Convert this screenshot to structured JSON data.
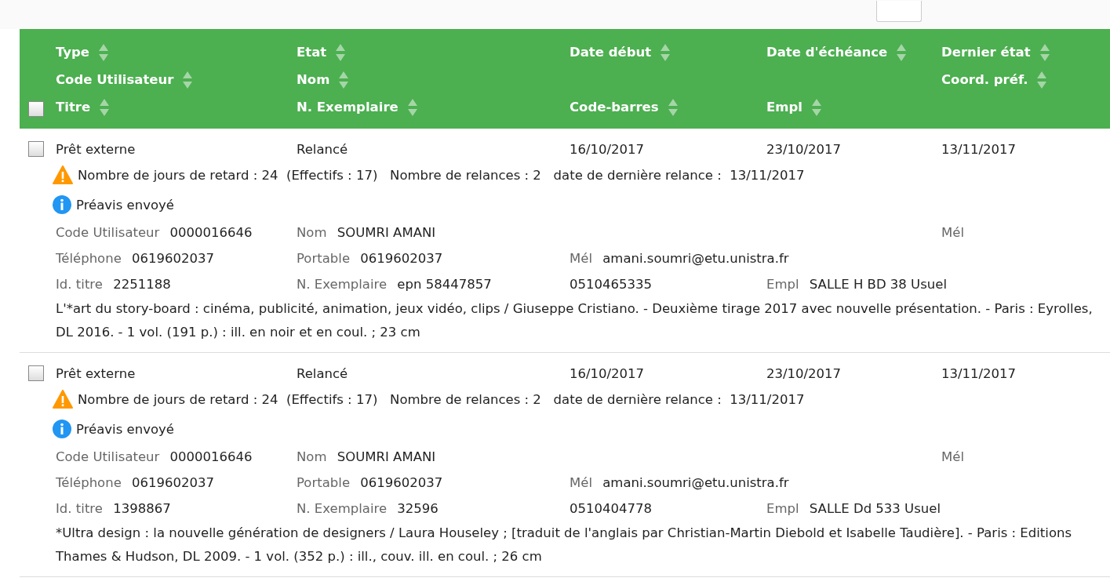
{
  "header": {
    "selected": false,
    "columns": [
      {
        "top": "Type",
        "middle": "Code Utilisateur",
        "bottom": "Titre"
      },
      {
        "top": "Etat",
        "middle": "Nom",
        "bottom": "N. Exemplaire"
      },
      {
        "top": "Date début",
        "bottom": "Code-barres"
      },
      {
        "top": "Date d'échéance",
        "bottom": "Empl"
      },
      {
        "top": "Dernier état",
        "middle": "Coord. préf."
      }
    ]
  },
  "rows": [
    {
      "selected": false,
      "cells": [
        "Prêt externe",
        "Relancé",
        "16/10/2017",
        "23/10/2017",
        "13/11/2017"
      ],
      "warning": "Nombre de jours de retard : 24  (Effectifs : 17)   Nombre de relances : 2   date de dernière relance :  13/11/2017",
      "info": "Préavis envoyé",
      "details": [
        {
          "column_1": {
            "label": "Code Utilisateur",
            "value": "0000016646"
          },
          "column_2": {
            "label": "Nom",
            "value": "SOUMRI AMANI"
          },
          "column_5": {
            "label": "Mél"
          }
        },
        {
          "column_1": {
            "label": "Téléphone",
            "value": "0619602037"
          },
          "column_2": {
            "label": "Portable",
            "value": "0619602037"
          },
          "column_3": {
            "label": "Mél",
            "value": "amani.soumri@etu.unistra.fr"
          }
        },
        {
          "column_1": {
            "label": "Id. titre",
            "value": "2251188"
          },
          "column_2": {
            "label": "N. Exemplaire",
            "value": "epn 58447857"
          },
          "column_3": {
            "value": "0510465335"
          },
          "column_4": {
            "label": "Empl",
            "value": "SALLE H BD 38 Usuel"
          }
        }
      ],
      "description": "L'*art du story-board : cinéma, publicité, animation, jeux vidéo, clips / Giuseppe Cristiano. - Deuxième tirage 2017 avec nouvelle présentation. - Paris : Eyrolles, DL 2016. - 1 vol. (191 p.) : ill. en noir et en coul. ; 23 cm"
    },
    {
      "selected": false,
      "cells": [
        "Prêt externe",
        "Relancé",
        "16/10/2017",
        "23/10/2017",
        "13/11/2017"
      ],
      "warning": "Nombre de jours de retard : 24  (Effectifs : 17)   Nombre de relances : 2   date de dernière relance :  13/11/2017",
      "info": "Préavis envoyé",
      "details": [
        {
          "column_1": {
            "label": "Code Utilisateur",
            "value": "0000016646"
          },
          "column_2": {
            "label": "Nom",
            "value": "SOUMRI AMANI"
          },
          "column_5": {
            "label": "Mél"
          }
        },
        {
          "column_1": {
            "label": "Téléphone",
            "value": "0619602037"
          },
          "column_2": {
            "label": "Portable",
            "value": "0619602037"
          },
          "column_3": {
            "label": "Mél",
            "value": "amani.soumri@etu.unistra.fr"
          }
        },
        {
          "column_1": {
            "label": "Id. titre",
            "value": "1398867"
          },
          "column_2": {
            "label": "N. Exemplaire",
            "value": "32596"
          },
          "column_3": {
            "value": "0510404778"
          },
          "column_4": {
            "label": "Empl",
            "value": "SALLE Dd 533 Usuel"
          }
        }
      ],
      "description": "*Ultra design : la nouvelle génération de designers / Laura Houseley ; [traduit de l'anglais par Christian-Martin Diebold et Isabelle Taudière]. - Paris : Editions Thames & Hudson, DL 2009. - 1 vol. (352 p.) : ill., couv. ill. en coul. ; 26 cm"
    }
  ]
}
